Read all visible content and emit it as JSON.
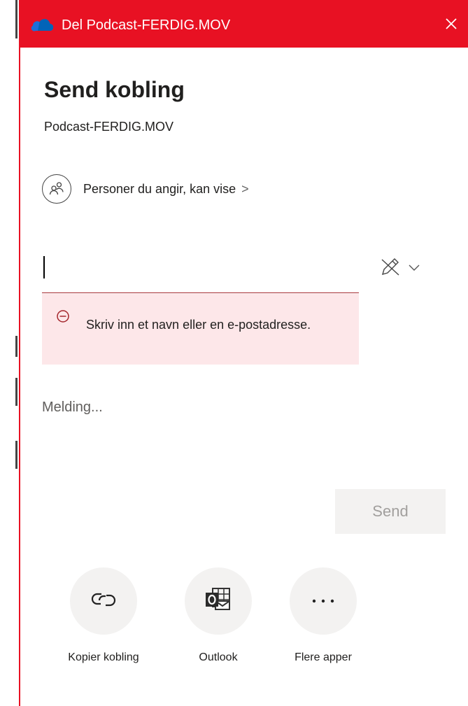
{
  "window": {
    "title": "Del Podcast-FERDIG.MOV",
    "accent_color": "#e81123",
    "close_icon": "close-icon",
    "app_icon": "onedrive-cloud-icon"
  },
  "share": {
    "heading": "Send kobling",
    "filename": "Podcast-FERDIG.MOV",
    "permission": {
      "label": "Personer du angir, kan vise",
      "chevron": ">",
      "icon": "people-icon"
    },
    "recipient": {
      "value": "",
      "error": "Skriv inn et navn eller en e-postadresse.",
      "error_icon": "minus-circle-icon",
      "edit_icon": "pencil-edit-icon"
    },
    "message": {
      "placeholder": "Melding..."
    },
    "send_label": "Send"
  },
  "options": [
    {
      "label": "Kopier kobling",
      "icon": "link-icon"
    },
    {
      "label": "Outlook",
      "icon": "outlook-icon"
    },
    {
      "label": "Flere apper",
      "icon": "more-icon"
    }
  ]
}
